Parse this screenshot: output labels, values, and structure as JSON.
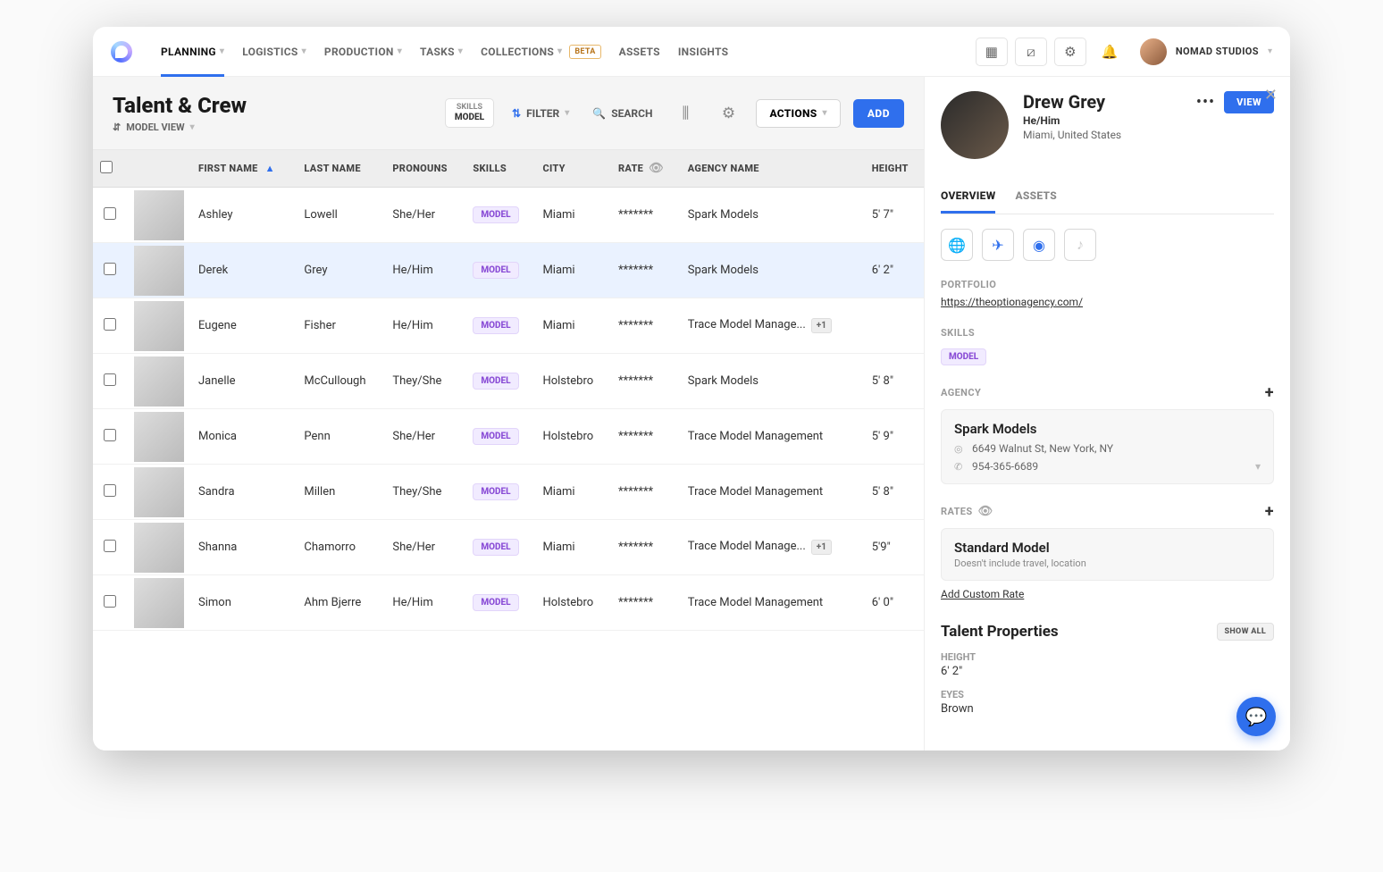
{
  "nav": {
    "items": [
      "PLANNING",
      "LOGISTICS",
      "PRODUCTION",
      "TASKS",
      "COLLECTIONS",
      "ASSETS",
      "INSIGHTS"
    ],
    "beta": "BETA",
    "user": "NOMAD STUDIOS"
  },
  "page": {
    "title": "Talent & Crew",
    "view": "MODEL VIEW",
    "skills_label": "SKILLS",
    "skills_value": "MODEL",
    "filter": "FILTER",
    "search": "SEARCH",
    "actions": "ACTIONS",
    "add": "ADD"
  },
  "columns": [
    "FIRST NAME",
    "LAST NAME",
    "PRONOUNS",
    "SKILLS",
    "CITY",
    "RATE",
    "AGENCY NAME",
    "HEIGHT"
  ],
  "rows": [
    {
      "first": "Ashley",
      "last": "Lowell",
      "pronouns": "She/Her",
      "skill": "MODEL",
      "city": "Miami",
      "rate": "*******",
      "agency": "Spark Models",
      "height": "5' 7\"",
      "selected": false,
      "overflow": ""
    },
    {
      "first": "Derek",
      "last": "Grey",
      "pronouns": "He/Him",
      "skill": "MODEL",
      "city": "Miami",
      "rate": "*******",
      "agency": "Spark Models",
      "height": "6' 2\"",
      "selected": true,
      "overflow": ""
    },
    {
      "first": "Eugene",
      "last": "Fisher",
      "pronouns": "He/Him",
      "skill": "MODEL",
      "city": "Miami",
      "rate": "*******",
      "agency": "Trace Model Manage...",
      "height": "",
      "selected": false,
      "overflow": "+1"
    },
    {
      "first": "Janelle",
      "last": "McCullough",
      "pronouns": "They/She",
      "skill": "MODEL",
      "city": "Holstebro",
      "rate": "*******",
      "agency": "Spark Models",
      "height": "5' 8\"",
      "selected": false,
      "overflow": ""
    },
    {
      "first": "Monica",
      "last": "Penn",
      "pronouns": "She/Her",
      "skill": "MODEL",
      "city": "Holstebro",
      "rate": "*******",
      "agency": "Trace Model Management",
      "height": "5' 9\"",
      "selected": false,
      "overflow": ""
    },
    {
      "first": "Sandra",
      "last": "Millen",
      "pronouns": "They/She",
      "skill": "MODEL",
      "city": "Miami",
      "rate": "*******",
      "agency": "Trace Model Management",
      "height": "5' 8\"",
      "selected": false,
      "overflow": ""
    },
    {
      "first": "Shanna",
      "last": "Chamorro",
      "pronouns": "She/Her",
      "skill": "MODEL",
      "city": "Miami",
      "rate": "*******",
      "agency": "Trace Model Manage...",
      "height": "5'9\"",
      "selected": false,
      "overflow": "+1"
    },
    {
      "first": "Simon",
      "last": "Ahm Bjerre",
      "pronouns": "He/Him",
      "skill": "MODEL",
      "city": "Holstebro",
      "rate": "*******",
      "agency": "Trace Model Management",
      "height": "6' 0\"",
      "selected": false,
      "overflow": ""
    }
  ],
  "detail": {
    "name": "Drew Grey",
    "pronouns": "He/Him",
    "location": "Miami, United States",
    "view_btn": "VIEW",
    "tabs": [
      "OVERVIEW",
      "ASSETS"
    ],
    "portfolio_label": "PORTFOLIO",
    "portfolio_url": "https://theoptionagency.com/",
    "skills_label": "SKILLS",
    "skill": "MODEL",
    "agency_label": "AGENCY",
    "agency_name": "Spark Models",
    "agency_addr": "6649 Walnut St, New York, NY",
    "agency_phone": "954-365-6689",
    "rates_label": "RATES",
    "rate_name": "Standard Model",
    "rate_desc": "Doesn't include travel, location",
    "add_rate": "Add Custom Rate",
    "props_title": "Talent Properties",
    "show_all": "SHOW ALL",
    "height_label": "HEIGHT",
    "height_val": "6' 2\"",
    "eyes_label": "EYES",
    "eyes_val": "Brown"
  }
}
